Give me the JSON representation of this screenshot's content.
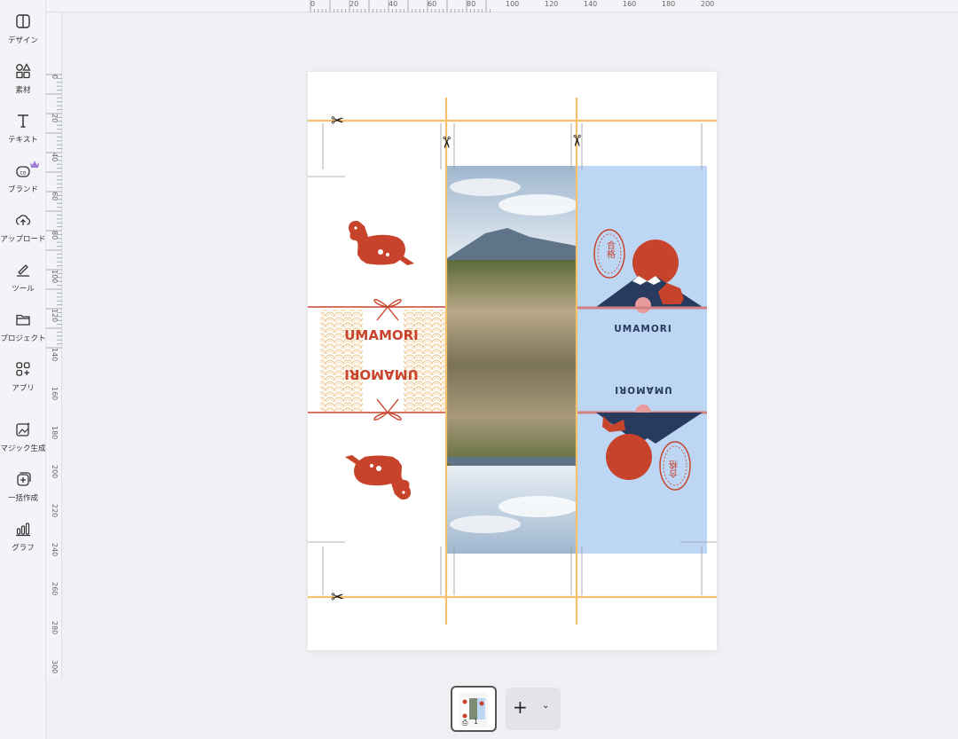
{
  "sidebar": {
    "items": [
      {
        "label": "デザイン",
        "icon": "design-panel-icon"
      },
      {
        "label": "素材",
        "icon": "elements-icon"
      },
      {
        "label": "テキスト",
        "icon": "text-icon"
      },
      {
        "label": "ブランド",
        "icon": "brand-icon"
      },
      {
        "label": "アップロード",
        "icon": "upload-cloud-icon"
      },
      {
        "label": "ツール",
        "icon": "draw-tool-icon"
      },
      {
        "label": "プロジェクト",
        "icon": "folder-icon"
      },
      {
        "label": "アプリ",
        "icon": "apps-icon"
      },
      {
        "label": "マジック生成",
        "icon": "magic-generate-icon"
      },
      {
        "label": "一括作成",
        "icon": "bulk-create-icon"
      },
      {
        "label": "グラフ",
        "icon": "chart-icon"
      }
    ]
  },
  "ruler": {
    "top": [
      "0",
      "20",
      "40",
      "60",
      "80",
      "100",
      "120",
      "140",
      "160",
      "180",
      "200"
    ],
    "left": [
      "0",
      "20",
      "40",
      "60",
      "80",
      "100",
      "120",
      "140",
      "160",
      "180",
      "200",
      "220",
      "240",
      "260",
      "280",
      "300"
    ]
  },
  "canvas": {
    "panel1_brand_top": "UMAMORI",
    "panel1_brand_bottom": "UMAMORI",
    "panel3_brand_top": "UMAMORI",
    "panel3_brand_bottom": "UMAMORI",
    "seal_top": "合格",
    "seal_bottom": "合格",
    "colors": {
      "accent": "#c8432b",
      "guide": "#f5c26b",
      "sky_panel": "#bcd6f4",
      "navy": "#283a5e"
    }
  },
  "pages": {
    "current": "1",
    "print_icon": "printer-icon"
  }
}
